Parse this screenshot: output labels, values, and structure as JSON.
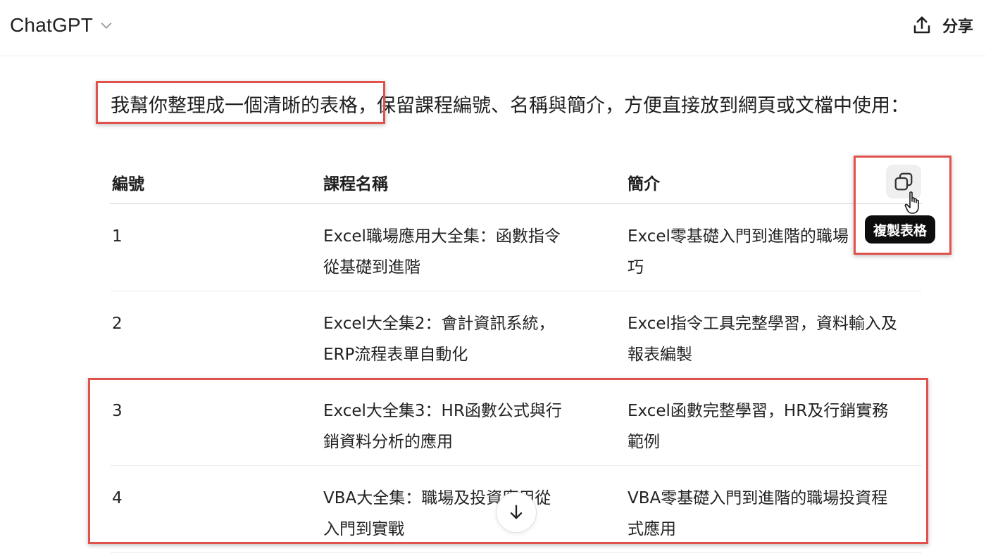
{
  "header": {
    "model_name": "ChatGPT",
    "share_label": "分享"
  },
  "message": {
    "intro_part1": "我幫你整理成一個清晰的表格",
    "intro_part2": "，保留課程編號、名稱與簡介，方便直接放到網頁或文檔中使用："
  },
  "table": {
    "headers": [
      "編號",
      "課程名稱",
      "簡介"
    ],
    "rows": [
      {
        "id": "1",
        "name": [
          "Excel職場應用大全集：函數指令",
          "從基礎到進階"
        ],
        "desc": [
          "Excel零基礎入門到進階的職場",
          "巧"
        ]
      },
      {
        "id": "2",
        "name": [
          "Excel大全集2：會計資訊系統，",
          "ERP流程表單自動化"
        ],
        "desc": [
          "Excel指令工具完整學習，資料輸入及",
          "報表編製"
        ]
      },
      {
        "id": "3",
        "name": [
          "Excel大全集3：HR函數公式與行",
          "銷資料分析的應用"
        ],
        "desc": [
          "Excel函數完整學習，HR及行銷實務",
          "範例"
        ]
      },
      {
        "id": "4",
        "name": [
          "VBA大全集：職場及投資應用從",
          "入門到實戰"
        ],
        "desc": [
          "VBA零基礎入門到進階的職場投資程",
          "式應用"
        ]
      }
    ]
  },
  "copy_table": {
    "tooltip": "複製表格"
  },
  "icons": {
    "model_dropdown": "chevron-down-icon",
    "share": "share-icon",
    "copy": "copy-icon",
    "cursor": "hand-pointer-icon",
    "scroll": "arrow-down-icon"
  },
  "colors": {
    "highlight": "#e0524c",
    "tooltip_bg": "#0d0d0d",
    "copy_btn_bg": "#efefef",
    "text": "#1f1f1f",
    "divider": "#ececec"
  }
}
